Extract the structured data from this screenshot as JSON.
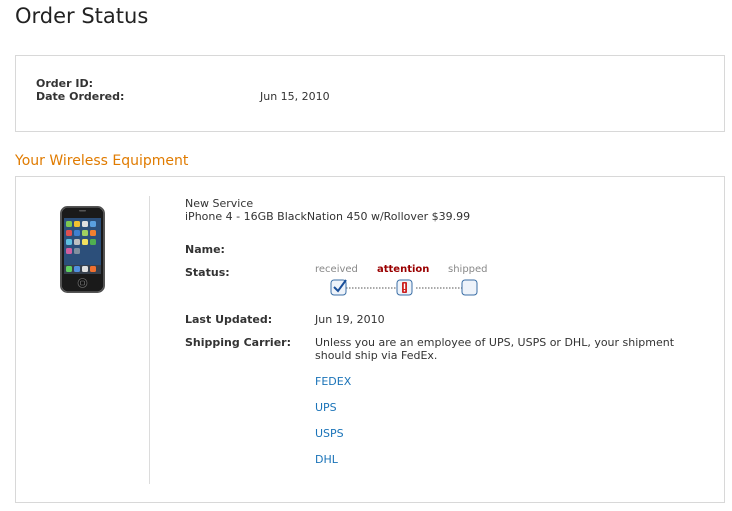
{
  "page": {
    "title": "Order Status"
  },
  "order": {
    "id_label": "Order ID:",
    "id_value": "",
    "date_label": "Date Ordered:",
    "date_value": "Jun 15, 2010"
  },
  "equipment": {
    "section_title": "Your Wireless Equipment",
    "service_type": "New Service",
    "plan": "iPhone 4 - 16GB BlackNation 450 w/Rollover $39.99",
    "name_label": "Name:",
    "name_value": "",
    "status_label": "Status:",
    "status_steps": [
      "received",
      "attention",
      "shipped"
    ],
    "status_current": "attention",
    "last_updated_label": "Last Updated:",
    "last_updated_value": "Jun 19, 2010",
    "shipping_label": "Shipping Carrier:",
    "shipping_note": "Unless you are an employee of UPS, USPS or DHL, your shipment should ship via FedEx.",
    "carriers": [
      "FEDEX",
      "UPS",
      "USPS",
      "DHL"
    ]
  },
  "icons": {
    "phone": "iphone-image",
    "received": "checkmark-icon",
    "attention": "exclamation-icon",
    "shipped": "empty-box-icon"
  },
  "colors": {
    "section_title": "#e07b00",
    "attention": "#9a0000",
    "link": "#1a73b8",
    "tracker_box_border": "#3a6ea5"
  }
}
